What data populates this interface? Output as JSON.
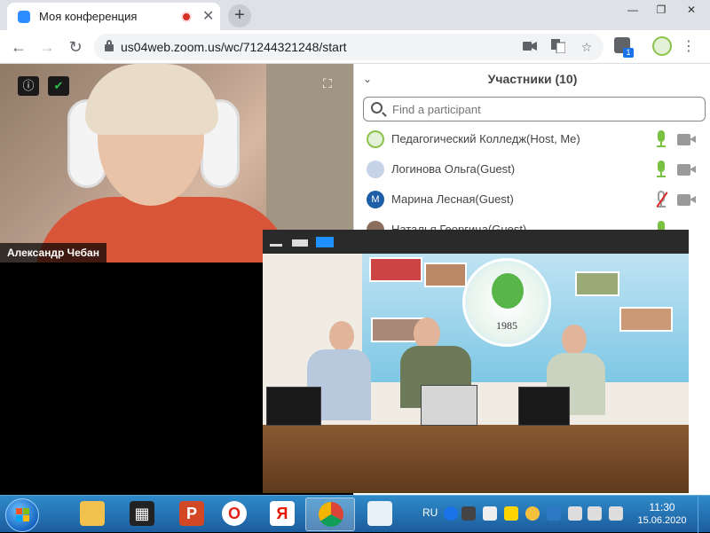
{
  "browser": {
    "tab_title": "Моя конференция",
    "url": "us04web.zoom.us/wc/71244321248/start",
    "extension_badge": "1",
    "tab_close": "✕",
    "newtab": "+",
    "window_min": "—",
    "window_max": "❐",
    "window_close": "✕",
    "back": "←",
    "forward": "→",
    "reload": "↻",
    "menu": "⋮"
  },
  "meeting": {
    "speaker_name": "Александр Чебан",
    "fullscreen_glyph": "⛶",
    "info_glyph": "ⓘ",
    "shield_glyph": "✔"
  },
  "participants": {
    "title": "Участники (10)",
    "search_placeholder": "Find a participant",
    "items": [
      {
        "name": "Педагогический Колледж(Host, Me)",
        "avatar": "",
        "mic": "on"
      },
      {
        "name": "Логинова Ольга(Guest)",
        "avatar": "",
        "mic": "on"
      },
      {
        "name": "Марина Лесная(Guest)",
        "avatar": "M",
        "mic": "off"
      },
      {
        "name": "Наталья Георгица(Guest)",
        "avatar": "",
        "mic": "on"
      }
    ]
  },
  "shared_video": {
    "emblem_year": "1985"
  },
  "taskbar": {
    "lang": "RU",
    "time": "11:30",
    "date": "15.06.2020",
    "apps": [
      "file-explorer",
      "video-player",
      "powerpoint",
      "opera",
      "yandex-browser",
      "chrome",
      "paint"
    ]
  },
  "colors": {
    "zoom_blue": "#2d8cff",
    "mic_green": "#7ac142",
    "mic_muted_red": "#e02828",
    "taskbar_blue": "#1c5d9e"
  }
}
